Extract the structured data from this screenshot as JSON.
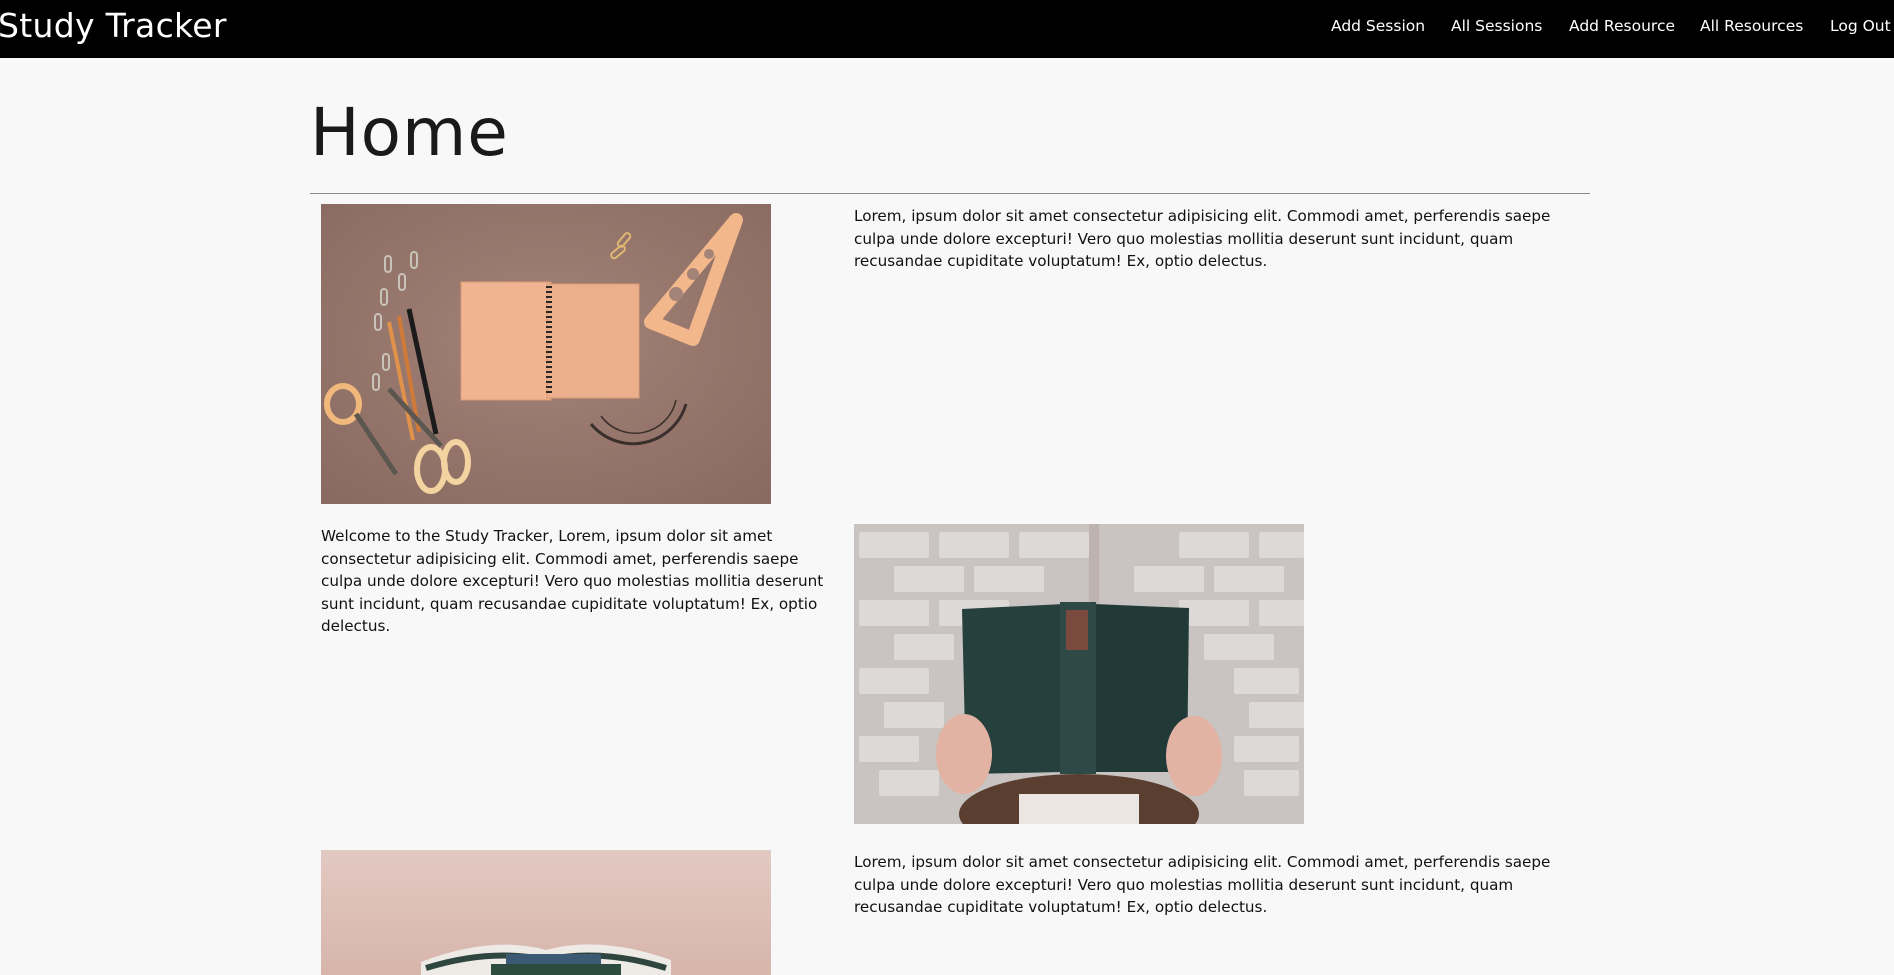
{
  "nav": {
    "brand": "Study Tracker",
    "links": [
      "Add Session",
      "All Sessions",
      "Add Resource",
      "All Resources",
      "Log Out"
    ]
  },
  "page": {
    "title": "Home"
  },
  "rows": [
    {
      "image_icon": "stationery-flatlay-image",
      "text": "Lorem, ipsum dolor sit amet consectetur adipisicing elit. Commodi amet, perferendis saepe culpa unde dolore excepturi! Vero quo molestias mollitia deserunt sunt incidunt, quam recusandae cupiditate voluptatum! Ex, optio delectus."
    },
    {
      "image_icon": "person-reading-book-image",
      "text": "Welcome to the Study Tracker, Lorem, ipsum dolor sit amet consectetur adipisicing elit. Commodi amet, perferendis saepe culpa unde dolore excepturi! Vero quo molestias mollitia deserunt sunt incidunt, quam recusandae cupiditate voluptatum! Ex, optio delectus."
    },
    {
      "image_icon": "stacked-books-image",
      "text": "Lorem, ipsum dolor sit amet consectetur adipisicing elit. Commodi amet, perferendis saepe culpa unde dolore excepturi! Vero quo molestias mollitia deserunt sunt incidunt, quam recusandae cupiditate voluptatum! Ex, optio delectus."
    }
  ],
  "colors": {
    "navbar_bg": "#000000",
    "page_bg": "#f8f8f8",
    "text": "#111111"
  }
}
